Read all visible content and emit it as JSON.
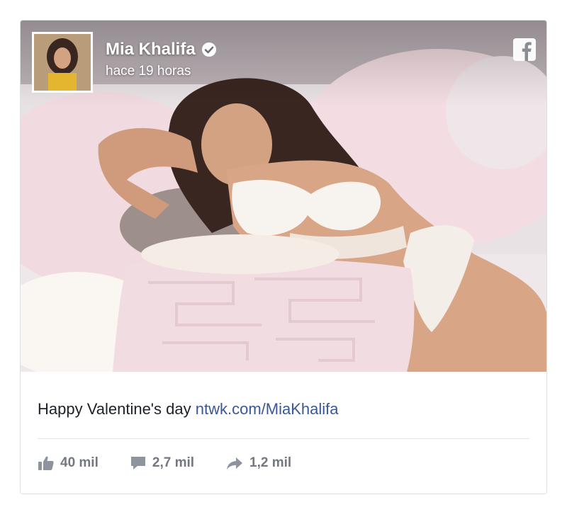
{
  "post": {
    "author": "Mia Khalifa",
    "verified_icon": "verified-check-icon",
    "time": "hace 19 horas",
    "network_icon": "facebook-icon",
    "caption_text": "Happy Valentine's day",
    "caption_link": "ntwk.com/MiaKhalifa"
  },
  "actions": {
    "likes_icon": "thumbs-up-icon",
    "likes": "40 mil",
    "comments_icon": "comment-icon",
    "comments": "2,7 mil",
    "shares_icon": "share-arrow-icon",
    "shares": "1,2 mil"
  },
  "colors": {
    "link": "#385898",
    "text": "#1d2129",
    "muted": "#737880",
    "border": "#dddfe2"
  }
}
